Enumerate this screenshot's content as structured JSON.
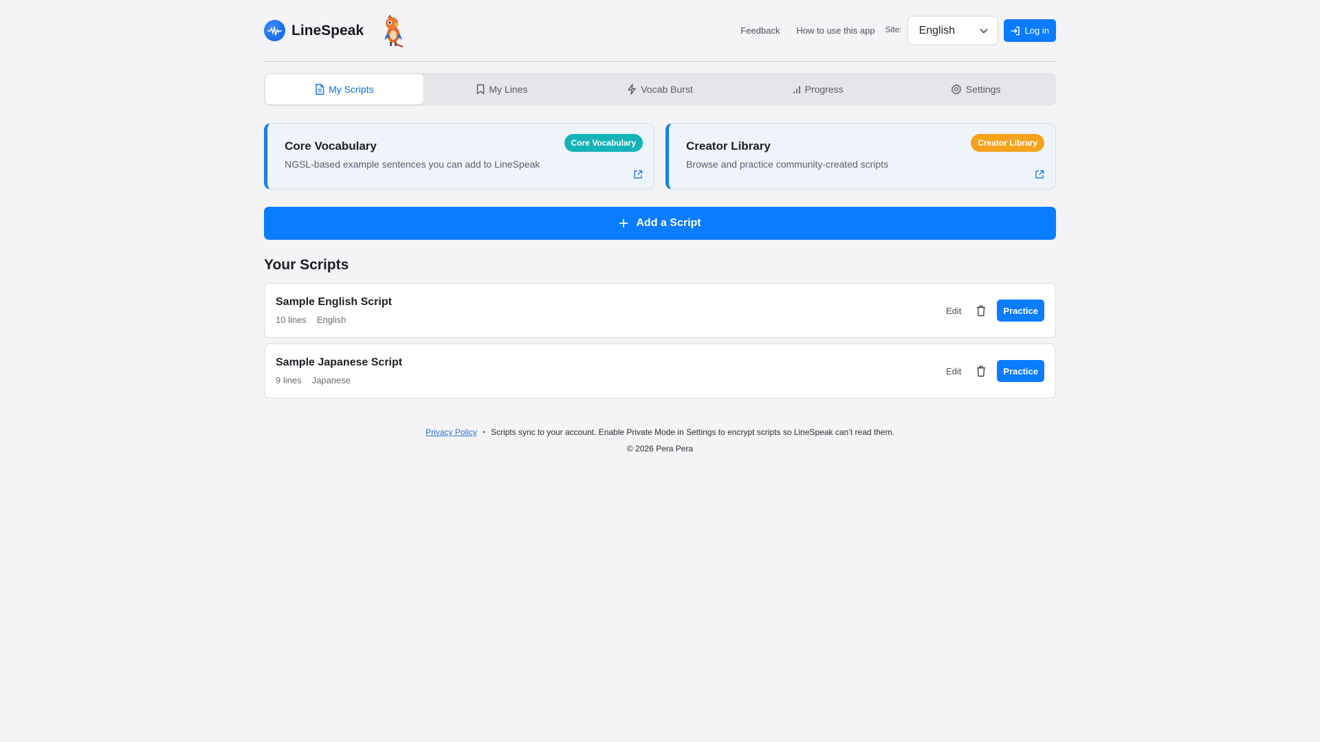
{
  "app": {
    "brand_name": "LineSpeak",
    "accent_color": "#0a7cff"
  },
  "header": {
    "links": [
      "Feedback",
      "How to use this app"
    ],
    "site_label": "Site:",
    "site_selected": "English",
    "login_label": "Log in"
  },
  "tabs": [
    {
      "label": "My Scripts",
      "icon": "document-icon",
      "active": true
    },
    {
      "label": "My Lines",
      "icon": "bookmark-icon",
      "active": false
    },
    {
      "label": "Vocab Burst",
      "icon": "lightning-icon",
      "active": false
    },
    {
      "label": "Progress",
      "icon": "bar-chart-icon",
      "active": false
    },
    {
      "label": "Settings",
      "icon": "gear-icon",
      "active": false
    }
  ],
  "feature_cards": [
    {
      "title": "Core Vocabulary",
      "description": "NGSL-based example sentences you can add to LineSpeak",
      "badge": "Core Vocabulary",
      "badge_color": "#14b3b8"
    },
    {
      "title": "Creator Library",
      "description": "Browse and practice community-created scripts",
      "badge": "Creator Library",
      "badge_color": "#f5a21c"
    }
  ],
  "add_script_label": "Add a Script",
  "scripts_section": {
    "title": "Your Scripts",
    "edit_label": "Edit",
    "practice_label": "Practice",
    "items": [
      {
        "name": "Sample English Script",
        "lines": "10 lines",
        "language": "English"
      },
      {
        "name": "Sample Japanese Script",
        "lines": "9 lines",
        "language": "Japanese"
      }
    ]
  },
  "footer": {
    "privacy_link": "Privacy Policy",
    "separator": "•",
    "notice": "Scripts sync to your account. Enable Private Mode in Settings to encrypt scripts so LineSpeak can’t read them.",
    "copyright": "© 2026 Pera Pera"
  }
}
